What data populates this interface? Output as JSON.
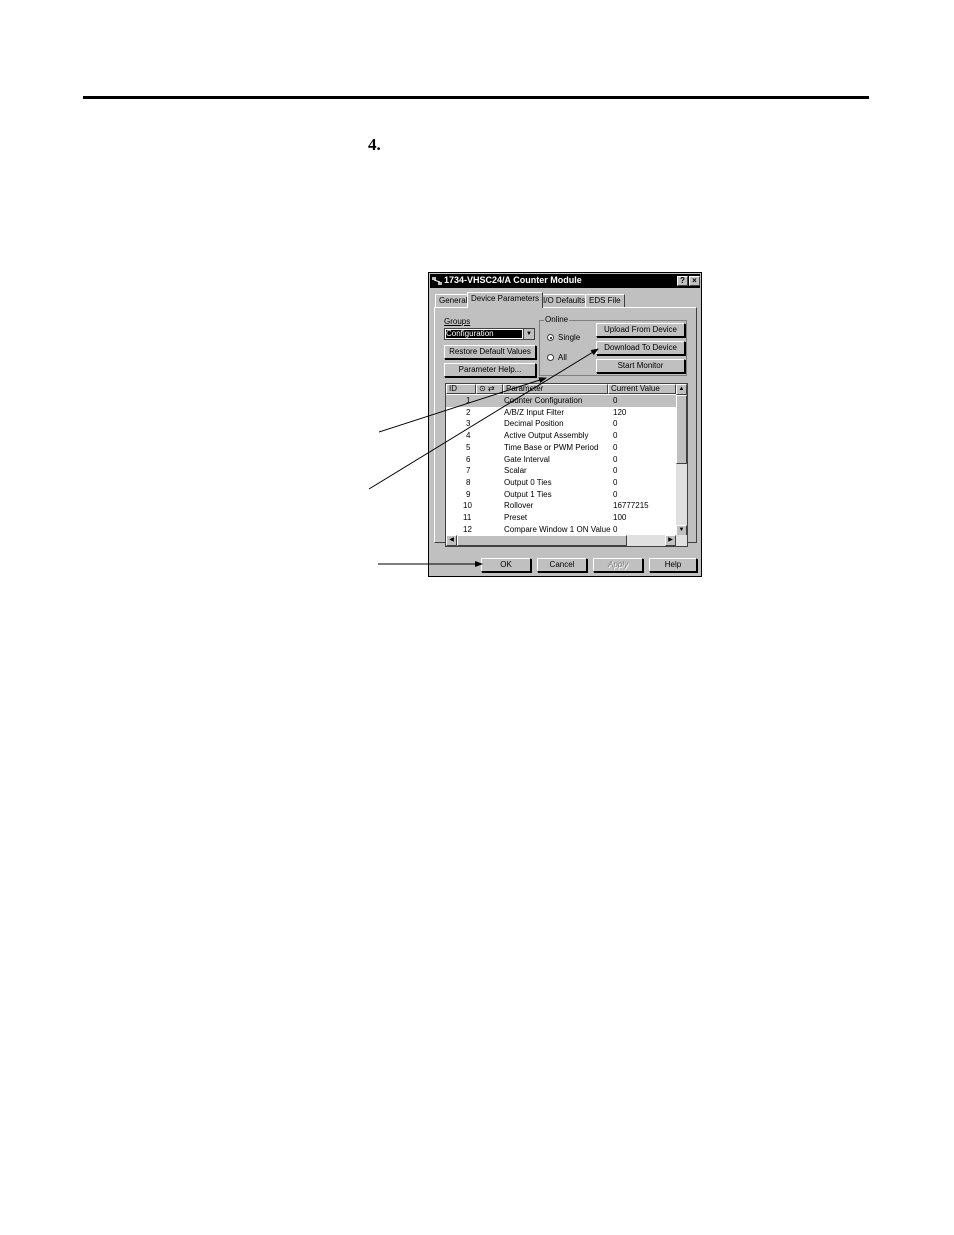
{
  "document": {
    "step_number": "4."
  },
  "dialog": {
    "title": "1734-VHSC24/A Counter Module",
    "help_btn": "?",
    "close_btn": "×",
    "tabs": [
      "General",
      "Device Parameters",
      "I/O Defaults",
      "EDS File"
    ],
    "groups_label": "Groups",
    "groups_value": "Configuration",
    "restore_btn": "Restore Default Values",
    "param_help_btn": "Parameter Help...",
    "online_label": "Online",
    "radio_single": "Single",
    "radio_all": "All",
    "upload_btn": "Upload From Device",
    "download_btn": "Download To Device",
    "start_monitor_btn": "Start Monitor",
    "columns": {
      "id": "ID",
      "icons": "⊙ ⇄",
      "parameter": "Parameter",
      "value": "Current Value"
    },
    "rows": [
      {
        "id": "1",
        "name": "Counter Configuration",
        "value": "0"
      },
      {
        "id": "2",
        "name": "A/B/Z Input Filter",
        "value": "120"
      },
      {
        "id": "3",
        "name": "Decimal Position",
        "value": "0"
      },
      {
        "id": "4",
        "name": "Active Output Assembly",
        "value": "0"
      },
      {
        "id": "5",
        "name": "Time Base or PWM Period",
        "value": "0"
      },
      {
        "id": "6",
        "name": "Gate Interval",
        "value": "0"
      },
      {
        "id": "7",
        "name": "Scalar",
        "value": "0"
      },
      {
        "id": "8",
        "name": "Output 0 Ties",
        "value": "0"
      },
      {
        "id": "9",
        "name": "Output 1 Ties",
        "value": "0"
      },
      {
        "id": "10",
        "name": "Rollover",
        "value": "16777215"
      },
      {
        "id": "11",
        "name": "Preset",
        "value": "100"
      },
      {
        "id": "12",
        "name": "Compare Window 1 ON Value",
        "value": "0"
      }
    ],
    "ok_btn": "OK",
    "cancel_btn": "Cancel",
    "apply_btn": "Apply",
    "help_btn_bottom": "Help",
    "selected_row_id": "1"
  }
}
